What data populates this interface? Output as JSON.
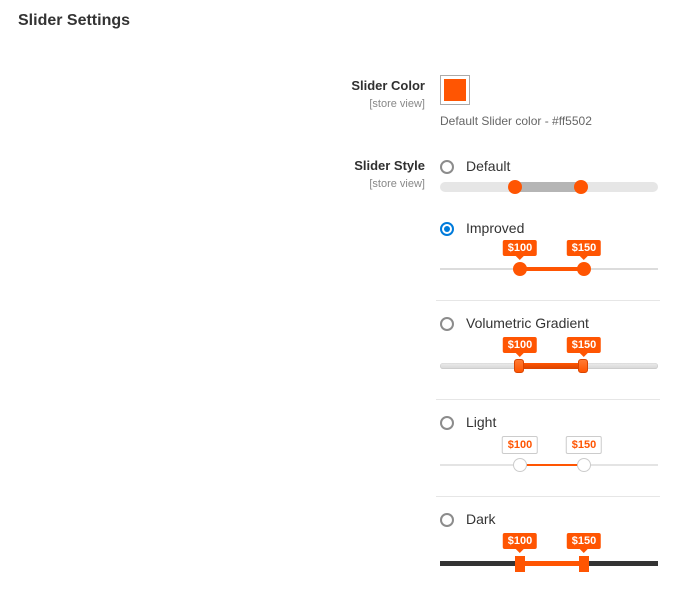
{
  "title": "Slider Settings",
  "scope_label": "[store view]",
  "slider_color": {
    "label": "Slider Color",
    "value": "#ff5502",
    "hint": "Default Slider color - #ff5502"
  },
  "slider_style": {
    "label": "Slider Style",
    "selected": "improved",
    "options": {
      "default": {
        "label": "Default"
      },
      "improved": {
        "label": "Improved",
        "low": "$100",
        "high": "$150"
      },
      "volumetric": {
        "label": "Volumetric Gradient",
        "low": "$100",
        "high": "$150"
      },
      "light": {
        "label": "Light",
        "low": "$100",
        "high": "$150"
      },
      "dark": {
        "label": "Dark",
        "low": "$100",
        "high": "$150"
      }
    }
  }
}
